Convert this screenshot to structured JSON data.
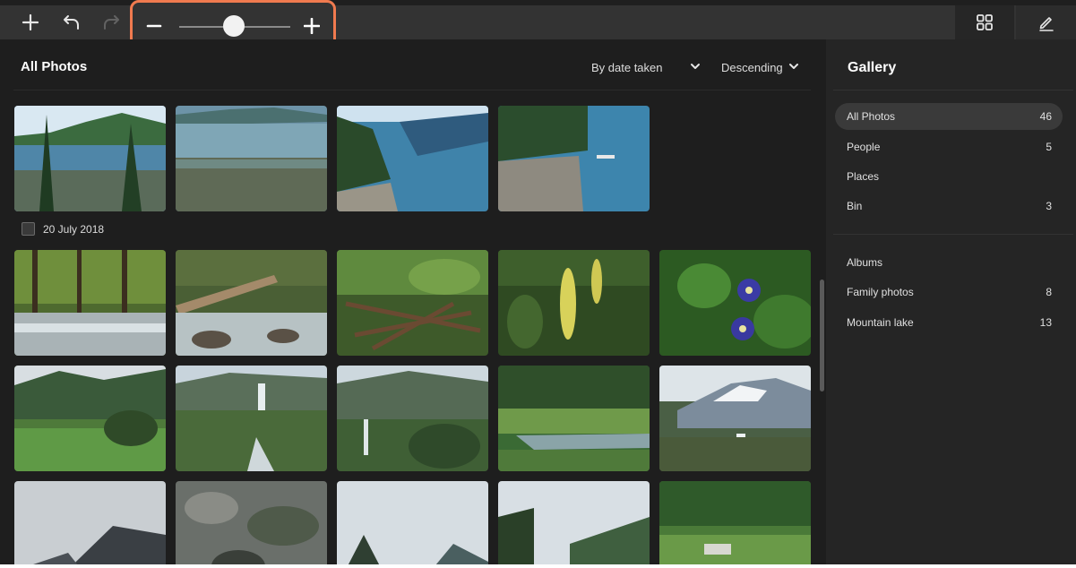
{
  "toolbar": {
    "add_icon": "plus-icon",
    "undo_icon": "undo-icon",
    "redo_icon": "redo-icon",
    "zoom": {
      "minus_icon": "minus-icon",
      "plus_icon": "plus-icon",
      "level": 0.5,
      "highlight_color": "#f07a4f"
    },
    "view_icon": "grid-view-icon",
    "edit_icon": "edit-pencil-icon"
  },
  "main": {
    "title": "All Photos",
    "sort_by": "By date taken",
    "sort_order": "Descending",
    "date_group_label": "20 July 2018"
  },
  "panel": {
    "title": "Gallery",
    "items": [
      {
        "label": "All Photos",
        "count": "46",
        "active": true
      },
      {
        "label": "People",
        "count": "5"
      },
      {
        "label": "Places",
        "count": ""
      },
      {
        "label": "Bin",
        "count": "3"
      }
    ],
    "albums_label": "Albums",
    "albums": [
      {
        "label": "Family photos",
        "count": "8"
      },
      {
        "label": "Mountain lake",
        "count": "13"
      }
    ]
  },
  "colors": {
    "background": "#1f1f1f",
    "toolbar": "#333333",
    "panel": "#252525",
    "accent": "#f07a4f"
  }
}
